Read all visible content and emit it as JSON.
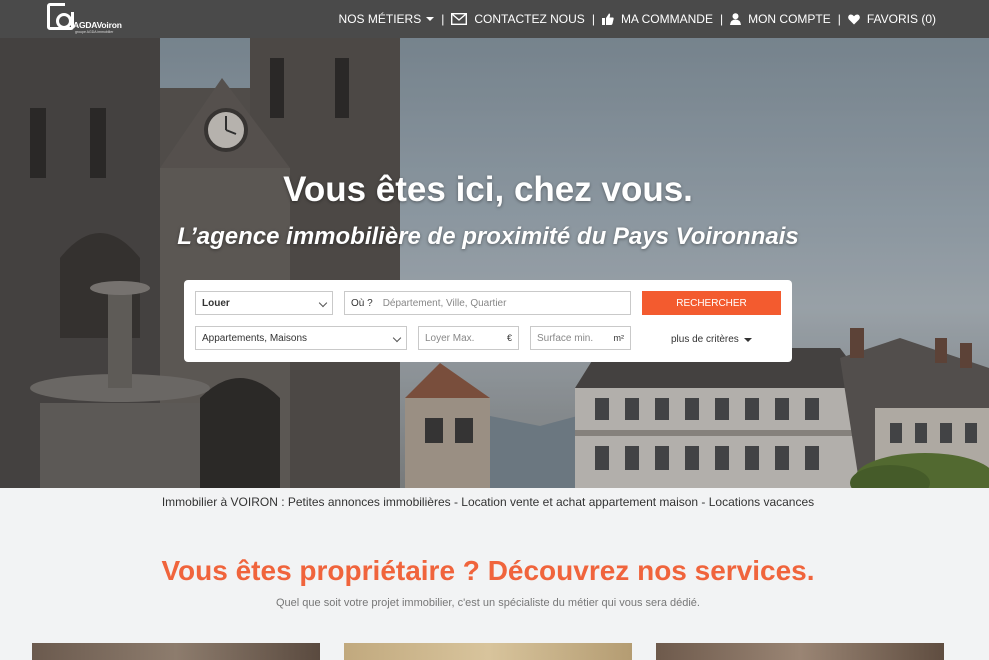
{
  "brand": {
    "name": "AGDAVoiron",
    "sub": "groupe AGDA immobilier"
  },
  "nav": {
    "items": [
      {
        "label": "NOS MÉTIERS",
        "icon": "caret-down-icon"
      },
      {
        "label": "CONTACTEZ NOUS",
        "icon": "envelope-icon"
      },
      {
        "label": "MA COMMANDE",
        "icon": "thumbs-up-icon"
      },
      {
        "label": "MON COMPTE",
        "icon": "user-icon"
      },
      {
        "label": "FAVORIS (0)",
        "icon": "heart-icon"
      }
    ]
  },
  "hero": {
    "title": "Vous êtes ici, chez vous.",
    "subtitle": "L’agence immobilière de proximité du Pays Voironnais"
  },
  "search": {
    "transaction": "Louer",
    "where_prefix": "Où ?",
    "where_placeholder": "Département, Ville, Quartier",
    "button": "RECHERCHER",
    "property_type": "Appartements, Maisons",
    "rent_placeholder": "Loyer Max.",
    "rent_unit": "€",
    "area_placeholder": "Surface min.",
    "area_unit": "m²",
    "more": "plus de critères"
  },
  "tagline": "Immobilier à VOIRON : Petites annonces immobilières - Location vente et achat appartement maison - Locations vacances",
  "services": {
    "title": "Vous êtes propriétaire ? Découvrez nos services.",
    "subtitle": "Quel que soit votre projet immobilier, c'est un spécialiste du métier qui vous sera dédié."
  },
  "colors": {
    "topbar": "#4a4a4a",
    "accent": "#f35b2f",
    "services_title": "#f0643c"
  }
}
